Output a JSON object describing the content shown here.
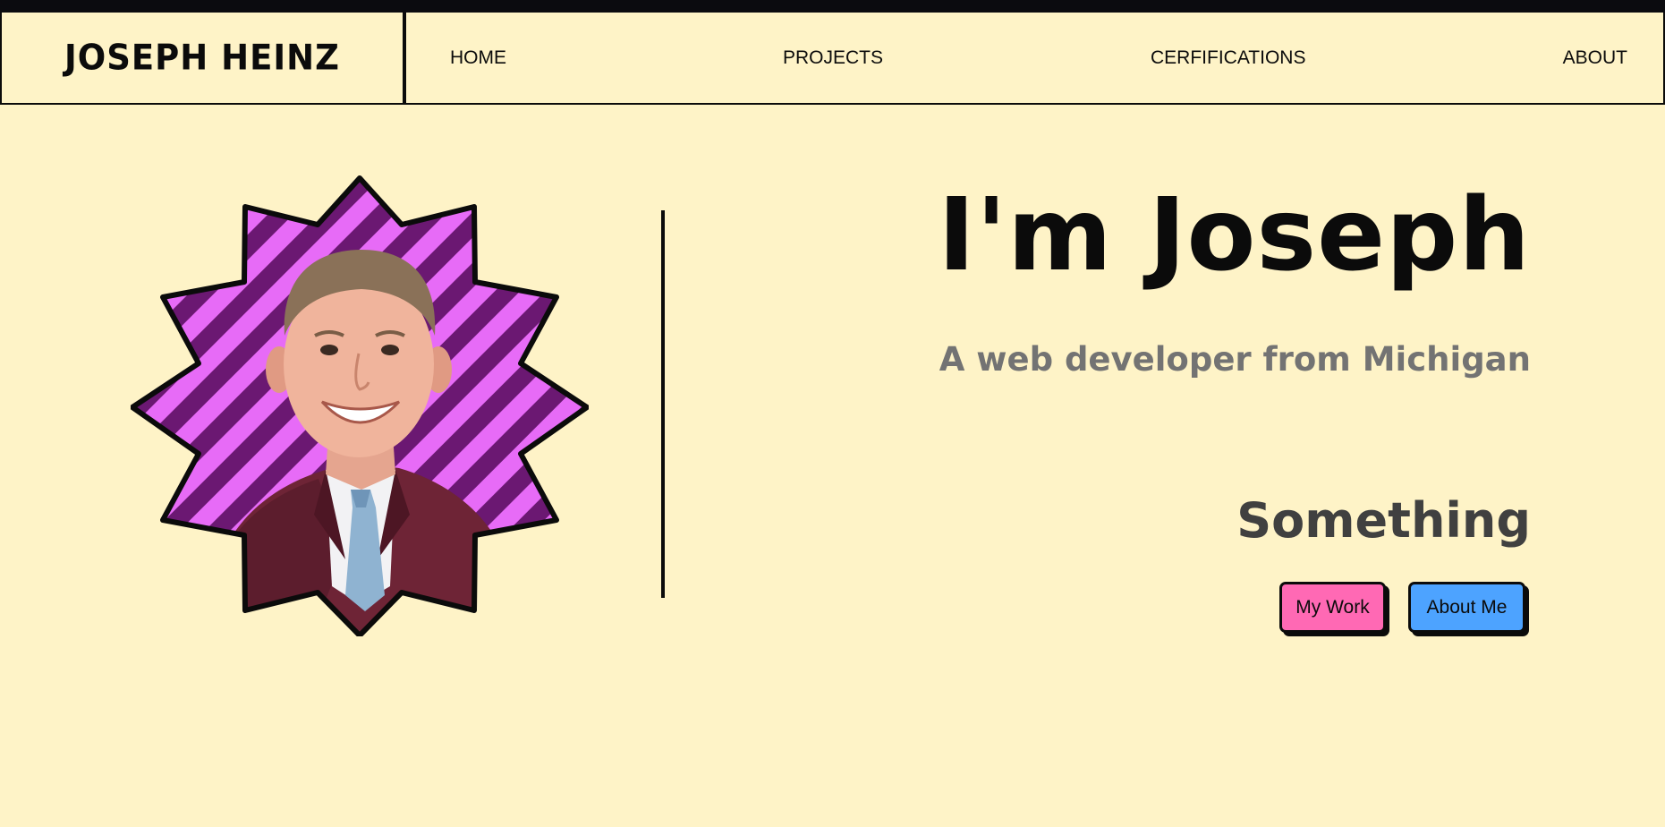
{
  "header": {
    "brand": "JOSEPH HEINZ",
    "nav": {
      "home": "HOME",
      "projects": "PROJECTS",
      "certifications": "CERFIFICATIONS",
      "about": "ABOUT"
    }
  },
  "hero": {
    "title": "I'm Joseph",
    "subtitle": "A web developer from Michigan",
    "tagline": "Something",
    "buttons": {
      "work": "My Work",
      "about": "About Me"
    },
    "portrait": {
      "shape": "twelve-point-star",
      "stripe_colors": [
        "#e76bf7",
        "#6b1872"
      ],
      "suit_color": "#6e2436",
      "tie_color": "#8fb3d1"
    }
  },
  "colors": {
    "background": "#fef3c7",
    "ink": "#0b0b0b",
    "button_pink": "#ff69b4",
    "button_blue": "#4da3ff",
    "subtitle_gray": "#737373",
    "tagline_gray": "#404040"
  }
}
